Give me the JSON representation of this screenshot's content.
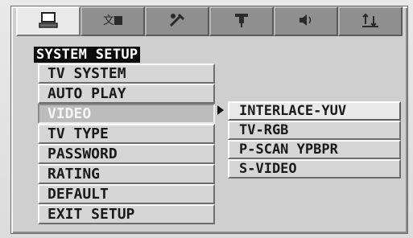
{
  "tabs": [
    {
      "icon": "computer-icon",
      "active": true
    },
    {
      "icon": "language-icon",
      "active": false
    },
    {
      "icon": "tools-icon",
      "active": false
    },
    {
      "icon": "video-plug-icon",
      "active": false
    },
    {
      "icon": "speaker-icon",
      "active": false
    },
    {
      "icon": "preference-icon",
      "active": false
    }
  ],
  "menu": {
    "title": "SYSTEM SETUP",
    "items": [
      {
        "label": "TV SYSTEM"
      },
      {
        "label": "AUTO PLAY"
      },
      {
        "label": "VIDEO",
        "selected": true
      },
      {
        "label": "TV TYPE"
      },
      {
        "label": "PASSWORD"
      },
      {
        "label": "RATING"
      },
      {
        "label": "DEFAULT"
      },
      {
        "label": "EXIT SETUP"
      }
    ]
  },
  "submenu": {
    "items": [
      {
        "label": "INTERLACE-YUV",
        "highlighted": true
      },
      {
        "label": "TV-RGB"
      },
      {
        "label": "P-SCAN YPBPR"
      },
      {
        "label": "S-VIDEO"
      }
    ]
  },
  "colors": {
    "panel_bg": "#cfcfcf",
    "header_bg": "#0c0c0c",
    "header_text": "#ffffff",
    "selected_item_bg": "#bcbcbc"
  }
}
